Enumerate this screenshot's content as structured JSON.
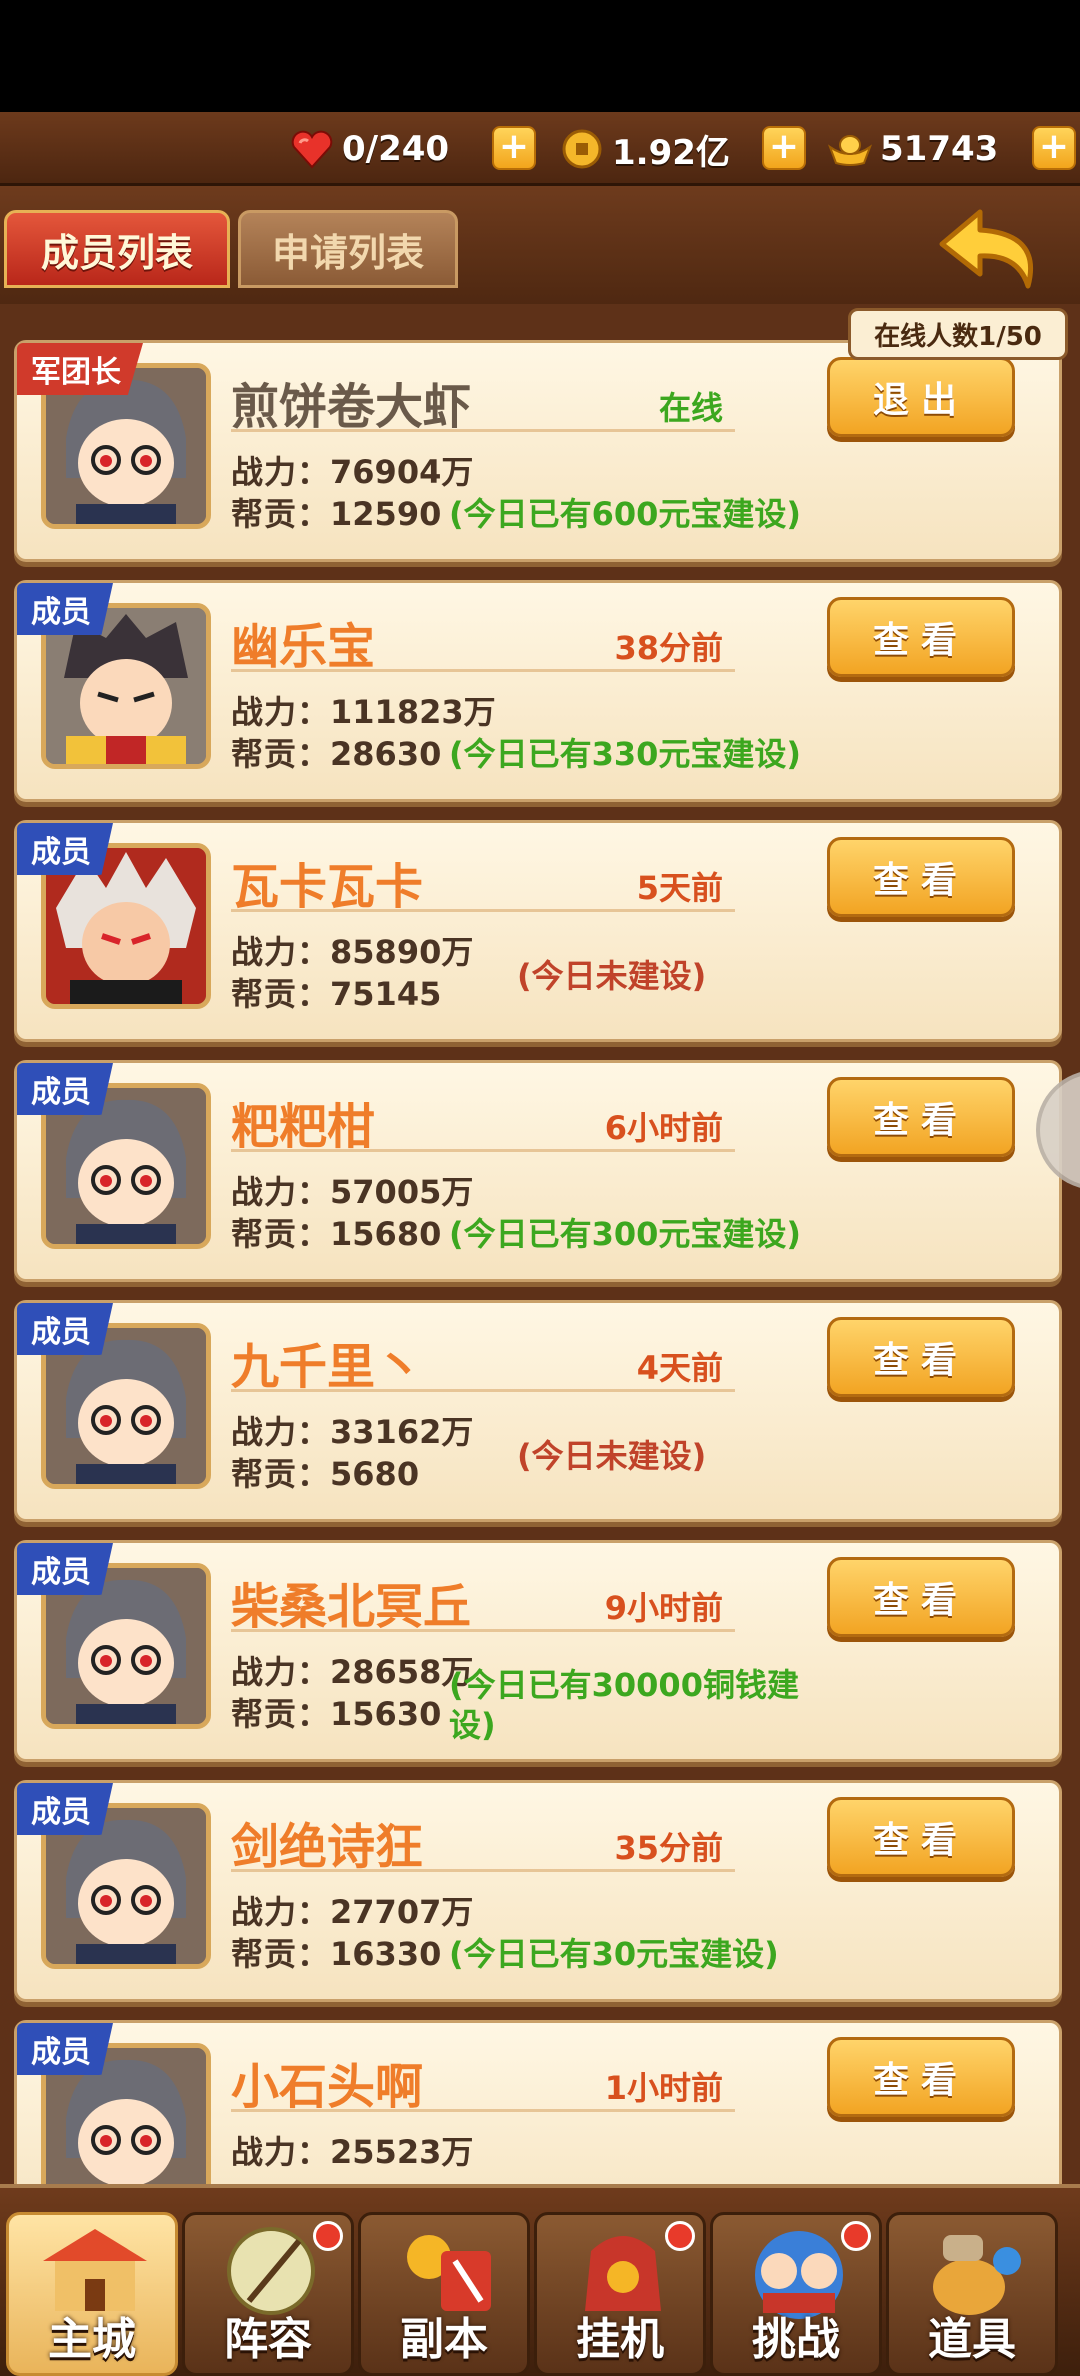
{
  "resources": {
    "stamina": "0/240",
    "coins": "1.92亿",
    "gold": "51743"
  },
  "tabs": {
    "members": "成员列表",
    "applications": "申请列表"
  },
  "online_count": "在线人数1/50",
  "labels": {
    "power": "战力：",
    "contrib": "帮贡："
  },
  "members": [
    {
      "rank": "军团长",
      "name": "煎饼卷大虾",
      "time": "在线",
      "power": "76904万",
      "contrib": "12590",
      "note": "(今日已有600元宝建设)",
      "button": "退出"
    },
    {
      "rank": "成员",
      "name": "幽乐宝",
      "time": "38分前",
      "power": "111823万",
      "contrib": "28630",
      "note": "(今日已有330元宝建设)",
      "button": "查看"
    },
    {
      "rank": "成员",
      "name": "瓦卡瓦卡",
      "time": "5天前",
      "power": "85890万",
      "contrib": "75145",
      "note": "(今日未建设)",
      "button": "查看"
    },
    {
      "rank": "成员",
      "name": "粑粑柑",
      "time": "6小时前",
      "power": "57005万",
      "contrib": "15680",
      "note": "(今日已有300元宝建设)",
      "button": "查看"
    },
    {
      "rank": "成员",
      "name": "九千里丶",
      "time": "4天前",
      "power": "33162万",
      "contrib": "5680",
      "note": "(今日未建设)",
      "button": "查看"
    },
    {
      "rank": "成员",
      "name": "柴桑北冥丘",
      "time": "9小时前",
      "power": "28658万",
      "contrib": "15630",
      "note": "(今日已有30000铜钱建设)",
      "button": "查看"
    },
    {
      "rank": "成员",
      "name": "剑绝诗狂",
      "time": "35分前",
      "power": "27707万",
      "contrib": "16330",
      "note": "(今日已有30元宝建设)",
      "button": "查看"
    },
    {
      "rank": "成员",
      "name": "小石头啊",
      "time": "1小时前",
      "power": "25523万",
      "contrib": "",
      "note": "",
      "button": "查看"
    }
  ],
  "nav": [
    {
      "label": "主城",
      "icon": "castle-icon"
    },
    {
      "label": "阵容",
      "icon": "lineup-icon"
    },
    {
      "label": "副本",
      "icon": "dungeon-icon"
    },
    {
      "label": "挂机",
      "icon": "idle-icon"
    },
    {
      "label": "挑战",
      "icon": "challenge-icon"
    },
    {
      "label": "道具",
      "icon": "items-icon"
    }
  ],
  "colors": {
    "accent_orange": "#ef7d2a",
    "online_green": "#3ca71f",
    "offline_red": "#d8501e",
    "rank_member_blue": "#2f4fb8",
    "rank_leader_red": "#d03a2b"
  }
}
